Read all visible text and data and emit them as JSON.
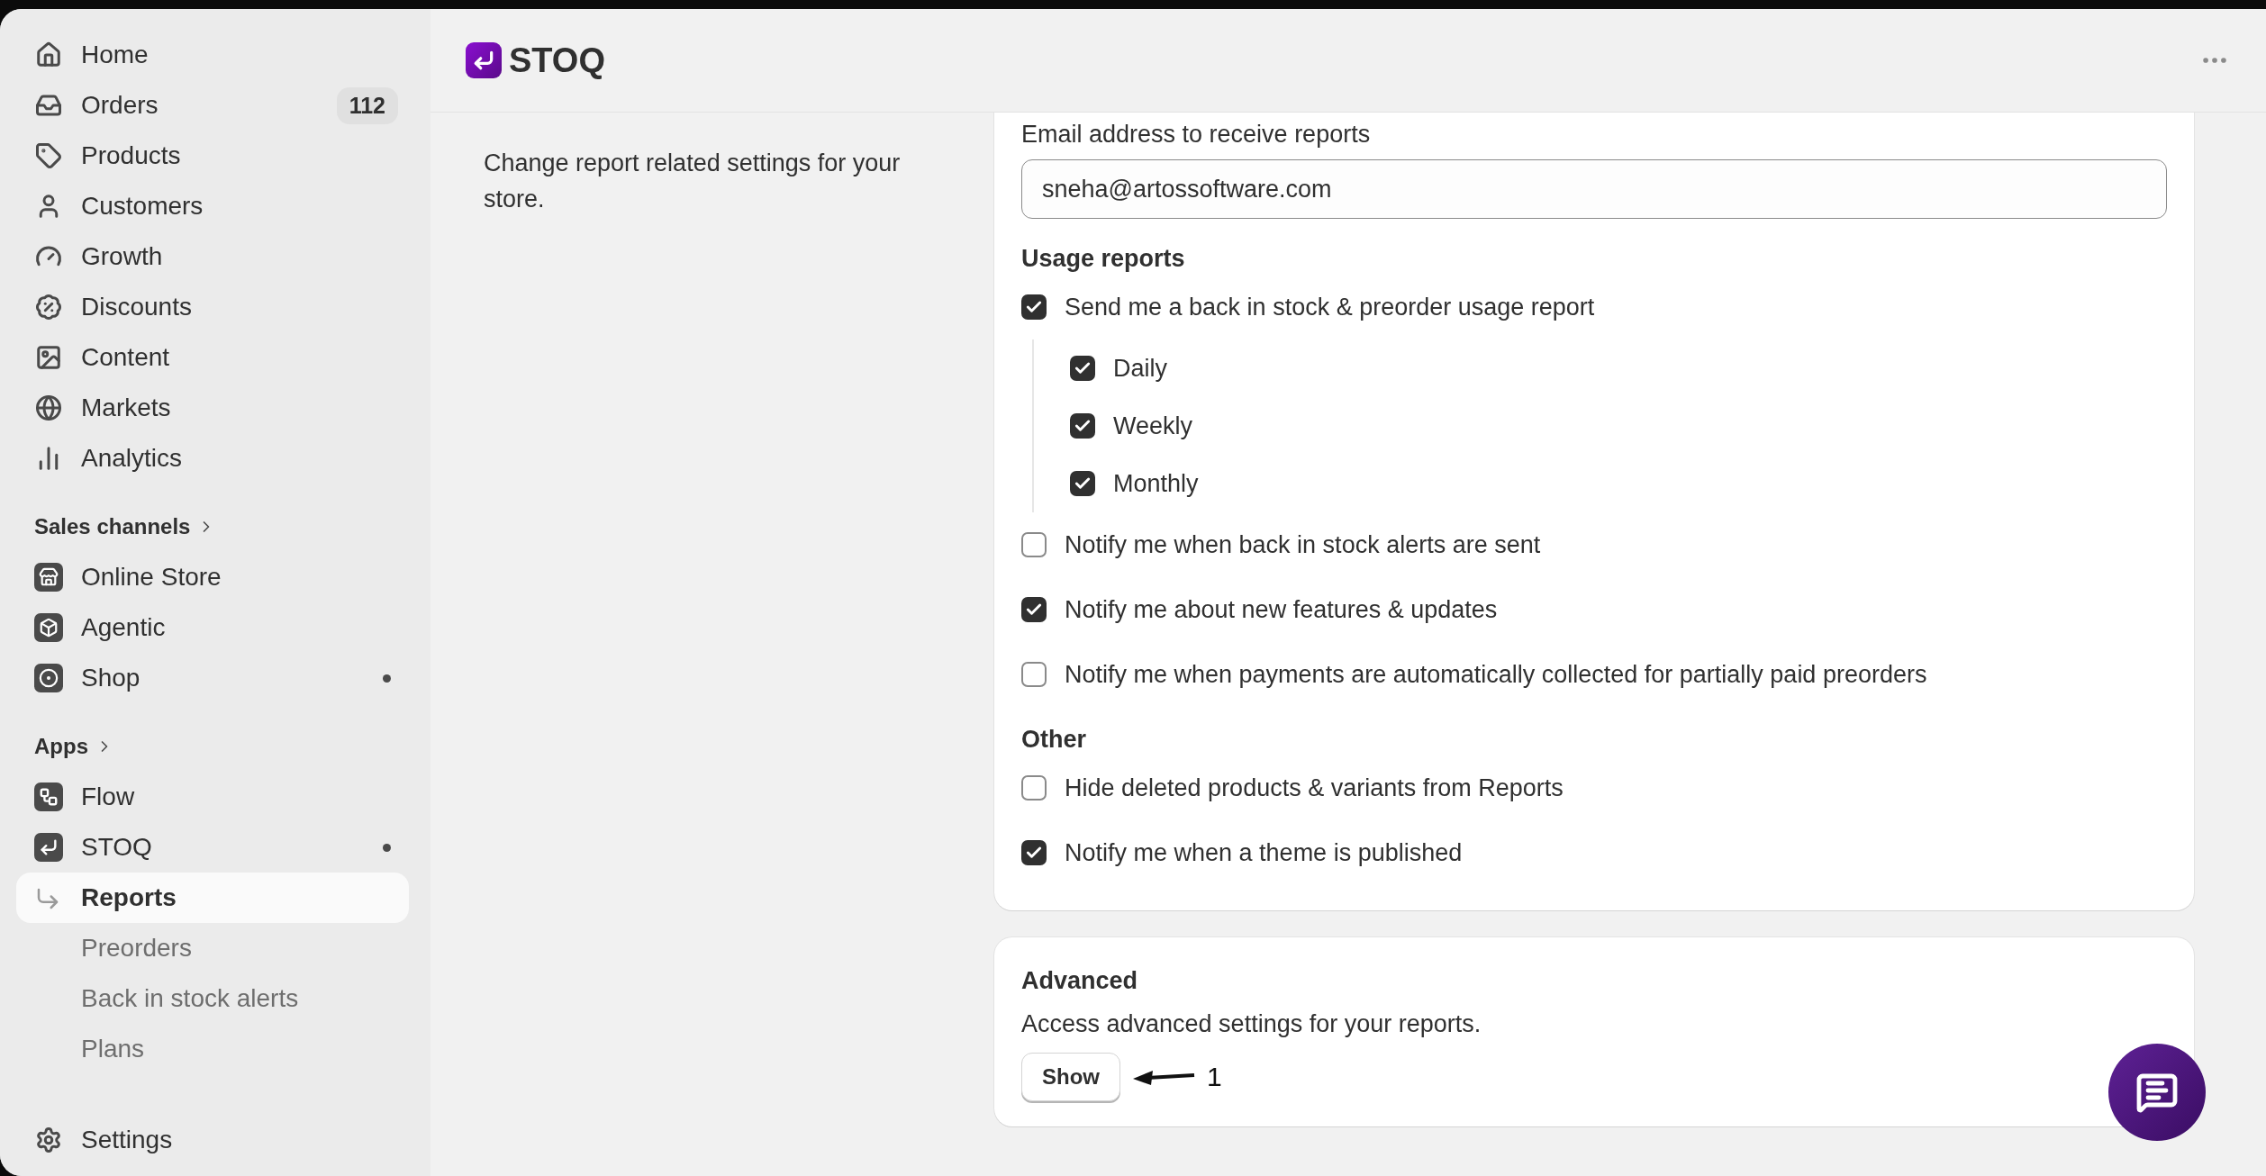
{
  "sidebar": {
    "items": [
      {
        "label": "Home",
        "dot": false
      },
      {
        "label": "Orders",
        "badge": "112",
        "dot": false
      },
      {
        "label": "Products",
        "dot": false
      },
      {
        "label": "Customers",
        "dot": false
      },
      {
        "label": "Growth",
        "dot": false
      },
      {
        "label": "Discounts",
        "dot": false
      },
      {
        "label": "Content",
        "dot": false
      },
      {
        "label": "Markets",
        "dot": false
      },
      {
        "label": "Analytics",
        "dot": false
      }
    ],
    "sales_channels": {
      "heading": "Sales channels",
      "items": [
        {
          "label": "Online Store",
          "dot": false
        },
        {
          "label": "Agentic",
          "dot": false
        },
        {
          "label": "Shop",
          "dot": true
        }
      ]
    },
    "apps": {
      "heading": "Apps",
      "items": [
        {
          "label": "Flow",
          "dot": false
        },
        {
          "label": "STOQ",
          "dot": true,
          "children": [
            {
              "label": "Reports",
              "selected": true
            },
            {
              "label": "Preorders",
              "selected": false
            },
            {
              "label": "Back in stock alerts",
              "selected": false
            },
            {
              "label": "Plans",
              "selected": false
            }
          ]
        }
      ]
    },
    "settings": "Settings"
  },
  "header": {
    "app_name": "STOQ"
  },
  "section": {
    "description": "Change report related settings for your store."
  },
  "reports_card": {
    "email_label": "Email address to receive reports",
    "email_value": "sneha@artossoftware.com",
    "groups": [
      {
        "heading": "Usage reports",
        "options": [
          {
            "label": "Send me a back in stock & preorder usage report",
            "checked": true,
            "children": [
              {
                "label": "Daily",
                "checked": true
              },
              {
                "label": "Weekly",
                "checked": true
              },
              {
                "label": "Monthly",
                "checked": true
              }
            ]
          },
          {
            "label": "Notify me when back in stock alerts are sent",
            "checked": false
          },
          {
            "label": "Notify me about new features & updates",
            "checked": true
          },
          {
            "label": "Notify me when payments are automatically collected for partially paid preorders",
            "checked": false
          }
        ]
      },
      {
        "heading": "Other",
        "options": [
          {
            "label": "Hide deleted products & variants from Reports",
            "checked": false
          },
          {
            "label": "Notify me when a theme is published",
            "checked": true
          }
        ]
      }
    ]
  },
  "advanced_card": {
    "heading": "Advanced",
    "description": "Access advanced settings for your reports.",
    "button": "Show",
    "annotation": "1"
  }
}
